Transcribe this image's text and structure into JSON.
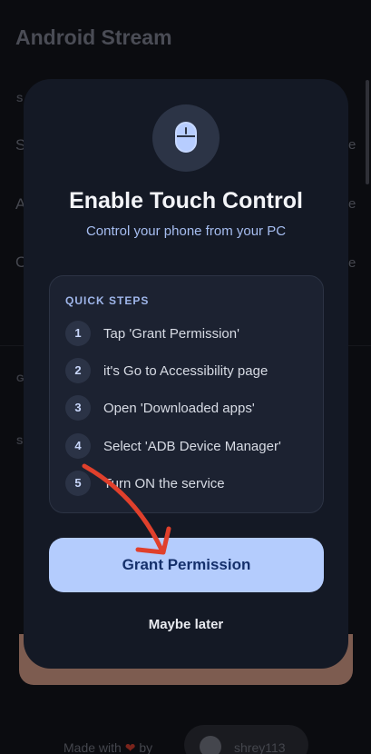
{
  "background": {
    "app_title": "Android Stream",
    "row_letters": [
      "S",
      "A",
      "C"
    ],
    "row_trailing": [
      "e",
      "e",
      "e"
    ],
    "section_letters": [
      "S",
      "G",
      "S"
    ],
    "footer_made_with": "Made with",
    "footer_by": "by",
    "github_user": "shrey113"
  },
  "modal": {
    "icon": "mouse-icon",
    "title": "Enable Touch Control",
    "subtitle": "Control your phone from your PC",
    "steps_heading": "QUICK STEPS",
    "steps": [
      {
        "num": "1",
        "text": "Tap 'Grant Permission'"
      },
      {
        "num": "2",
        "text": "it's Go to Accessibility page"
      },
      {
        "num": "3",
        "text": "Open 'Downloaded apps'"
      },
      {
        "num": "4",
        "text": "Select 'ADB Device Manager'"
      },
      {
        "num": "5",
        "text": "Turn ON the service"
      }
    ],
    "primary_button": "Grant Permission",
    "secondary_button": "Maybe later"
  },
  "colors": {
    "modal_bg": "#141925",
    "accent": "#b4ccfd",
    "annotation_arrow": "#e0402c"
  }
}
